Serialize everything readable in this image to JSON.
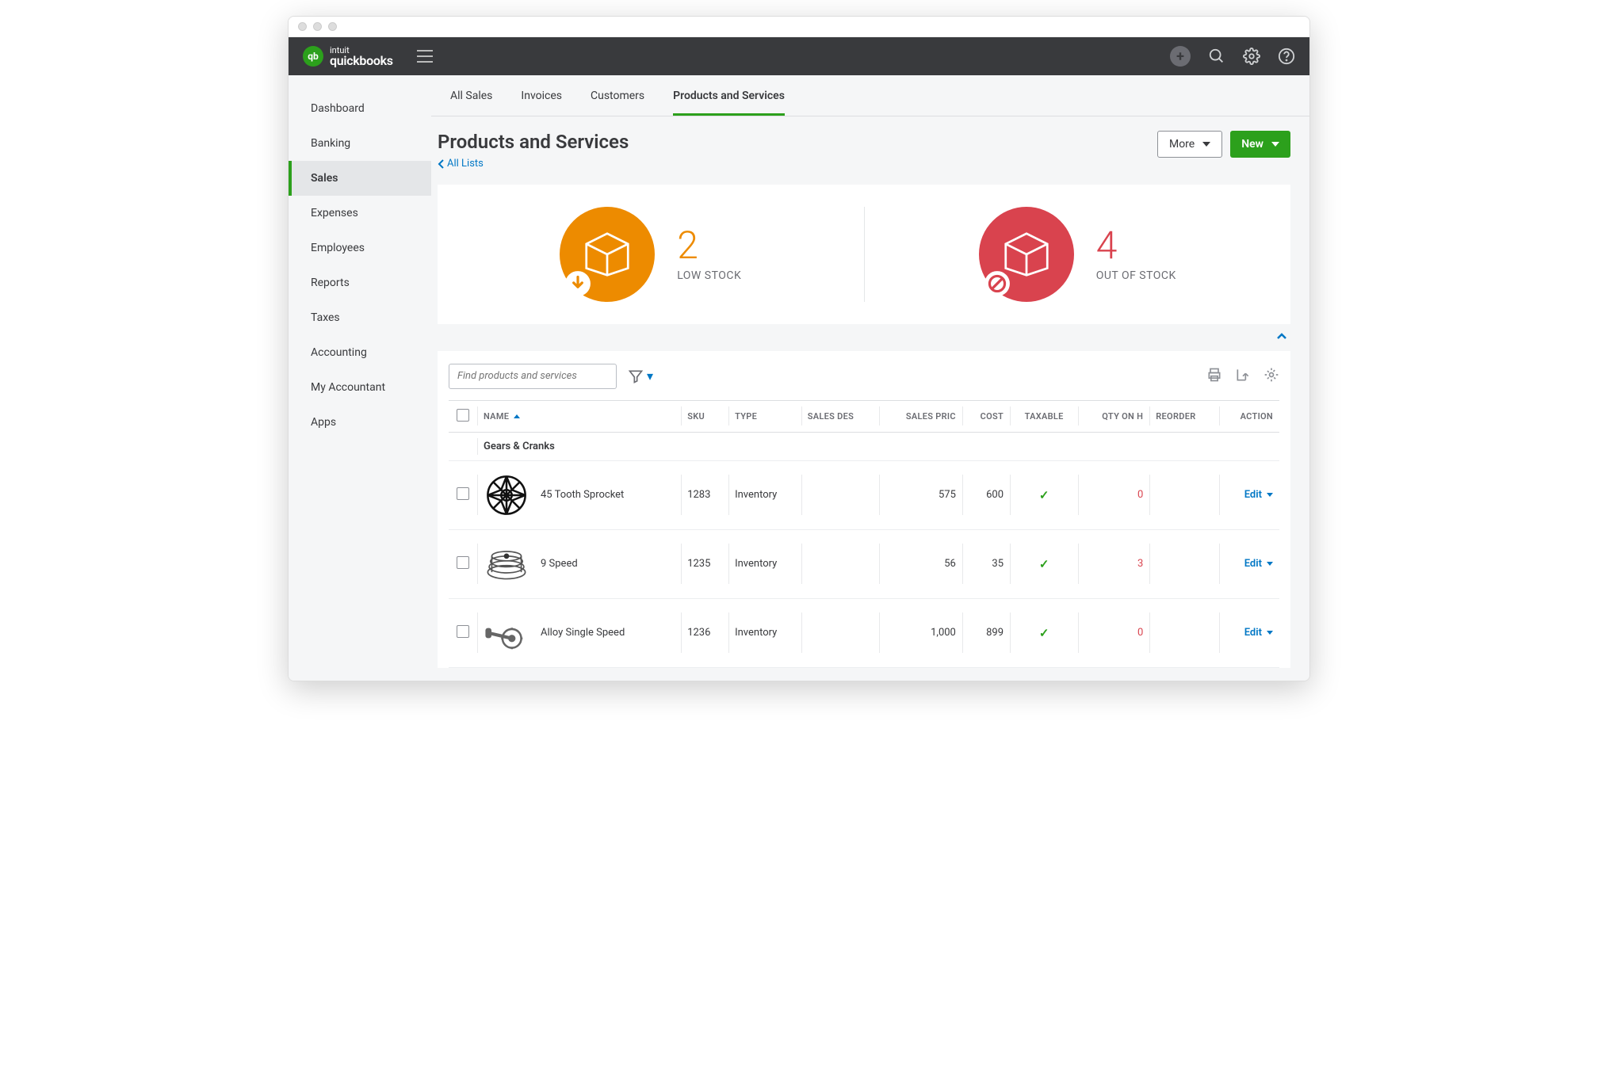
{
  "logo": {
    "badge": "qb",
    "top": "intuit",
    "brand": "quickbooks"
  },
  "sidenav": {
    "items": [
      {
        "label": "Dashboard"
      },
      {
        "label": "Banking"
      },
      {
        "label": "Sales",
        "active": true
      },
      {
        "label": "Expenses"
      },
      {
        "label": "Employees"
      },
      {
        "label": "Reports"
      },
      {
        "label": "Taxes"
      },
      {
        "label": "Accounting"
      },
      {
        "label": "My Accountant"
      },
      {
        "label": "Apps"
      }
    ]
  },
  "tabs": [
    {
      "label": "All Sales"
    },
    {
      "label": "Invoices"
    },
    {
      "label": "Customers"
    },
    {
      "label": "Products and Services",
      "active": true
    }
  ],
  "page": {
    "title": "Products and Services",
    "back_link": "All Lists",
    "more_btn": "More",
    "new_btn": "New"
  },
  "stock": {
    "low": {
      "count": "2",
      "label": "LOW STOCK"
    },
    "out": {
      "count": "4",
      "label": "OUT OF STOCK"
    }
  },
  "table": {
    "search_placeholder": "Find products and services",
    "columns": {
      "name": "NAME",
      "sku": "SKU",
      "type": "TYPE",
      "desc": "SALES DES",
      "price": "SALES PRIC",
      "cost": "COST",
      "taxable": "TAXABLE",
      "qty": "QTY ON H",
      "reorder": "REORDER",
      "action": "ACTION"
    },
    "group": "Gears & Cranks",
    "edit_label": "Edit",
    "rows": [
      {
        "name": "45 Tooth Sprocket",
        "sku": "1283",
        "type": "Inventory",
        "price": "575",
        "cost": "600",
        "qty": "0"
      },
      {
        "name": "9 Speed",
        "sku": "1235",
        "type": "Inventory",
        "price": "56",
        "cost": "35",
        "qty": "3"
      },
      {
        "name": "Alloy Single Speed",
        "sku": "1236",
        "type": "Inventory",
        "price": "1,000",
        "cost": "899",
        "qty": "0"
      }
    ]
  }
}
